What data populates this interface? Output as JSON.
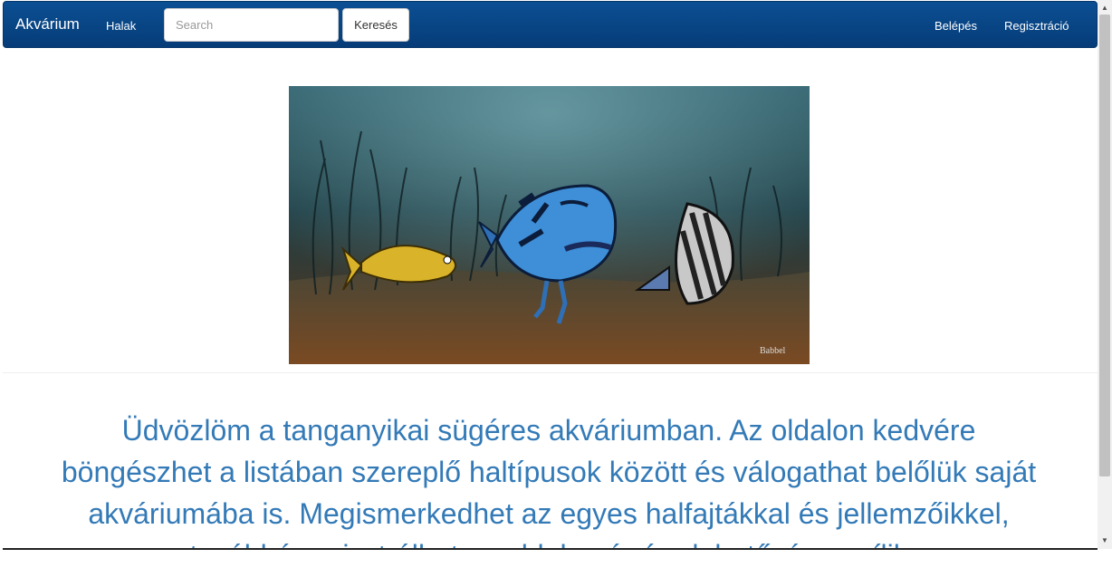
{
  "navbar": {
    "brand": "Akvárium",
    "links_left": [
      {
        "label": "Halak"
      }
    ],
    "search": {
      "placeholder": "Search",
      "value": "",
      "button_label": "Keresés"
    },
    "links_right": [
      {
        "label": "Belépés"
      },
      {
        "label": "Regisztráció"
      }
    ],
    "color": "#0b4f93"
  },
  "hero_image": {
    "signature": "Babbel"
  },
  "welcome_text": "Üdvözlöm a tanganyikai sügéres akváriumban. Az oldalon kedvére böngészhet a listában szereplő haltípusok között és válogathat belőlük saját akváriumába is. Megismerkedhet az egyes halfajtákkal és jellemzőikkel, továbbá regisztrálhat az oldalon és így lehetősége nyílik",
  "colors": {
    "text_accent": "#337ab7"
  }
}
